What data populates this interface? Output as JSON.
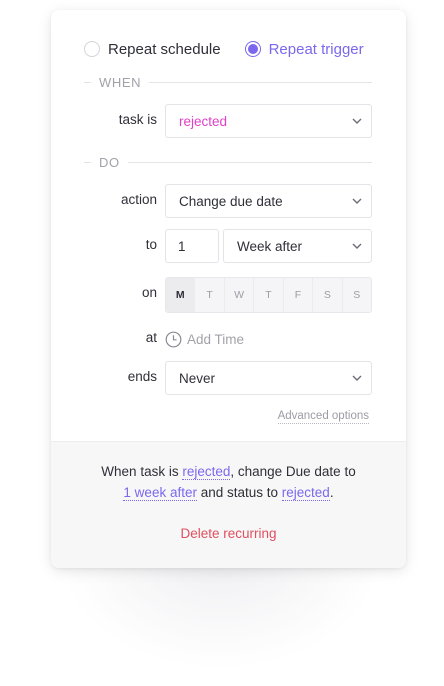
{
  "radio": {
    "schedule_label": "Repeat schedule",
    "trigger_label": "Repeat trigger",
    "selected": "trigger"
  },
  "sections": {
    "when": "WHEN",
    "do": "DO"
  },
  "labels": {
    "task_is": "task is",
    "action": "action",
    "to": "to",
    "on": "on",
    "at": "at",
    "ends": "ends"
  },
  "fields": {
    "task_status": "rejected",
    "action": "Change due date",
    "interval_value": "1",
    "interval_unit": "Week after",
    "add_time_placeholder": "Add Time",
    "ends": "Never"
  },
  "days": [
    {
      "label": "M",
      "active": true
    },
    {
      "label": "T",
      "active": false
    },
    {
      "label": "W",
      "active": false
    },
    {
      "label": "T",
      "active": false
    },
    {
      "label": "F",
      "active": false
    },
    {
      "label": "S",
      "active": false
    },
    {
      "label": "S",
      "active": false
    }
  ],
  "advanced_options": "Advanced options",
  "summary": {
    "prefix": "When task is ",
    "status": "rejected",
    "mid": ", change Due date to",
    "interval": "1 week after",
    "and_status": " and status to ",
    "new_status": "rejected",
    "end": "."
  },
  "delete_label": "Delete recurring",
  "colors": {
    "accent": "#7b68ee",
    "status_pink": "#e040c8",
    "danger": "#e04f5f"
  },
  "icons": {
    "chevron": "chevron-down-icon",
    "clock": "clock-icon"
  }
}
